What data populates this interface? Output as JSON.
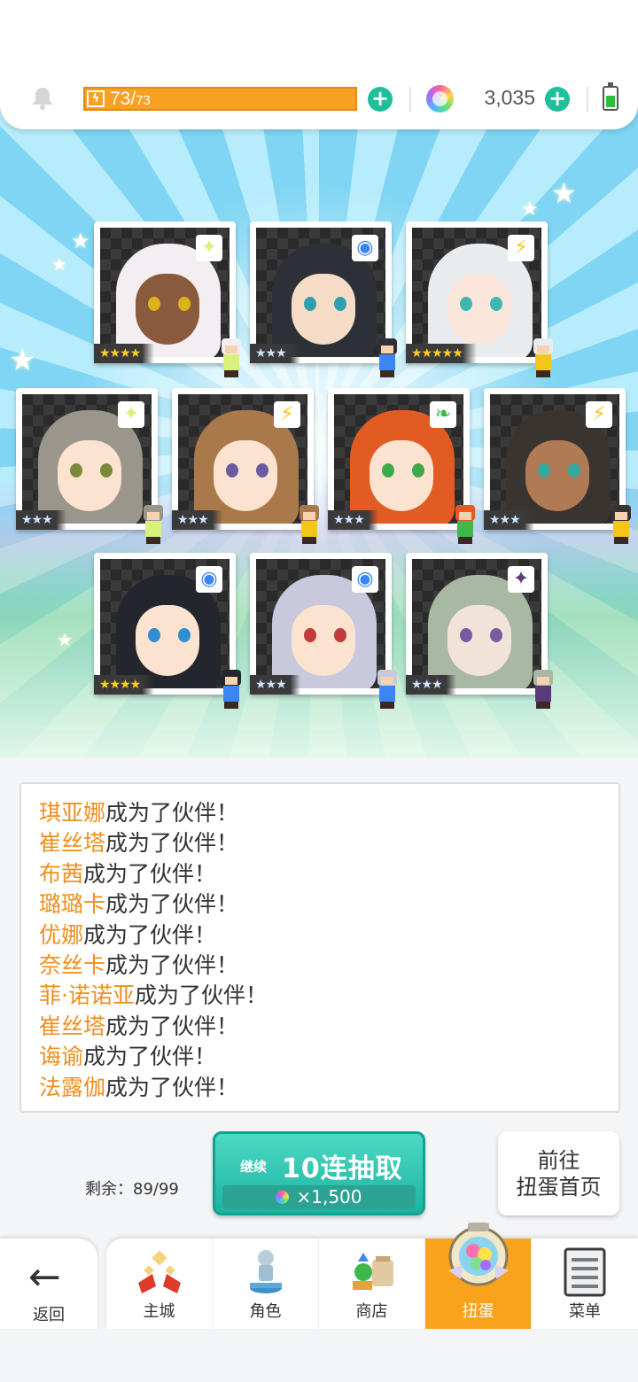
{
  "status": {
    "stamina_current": "73/",
    "stamina_max": "73",
    "gems": "3,035",
    "bolt_icon": "lightning-icon"
  },
  "cards": [
    {
      "stars": "★★★★",
      "rarity": "gold",
      "element": "light",
      "element_glyph": "✦",
      "element_color": "#d9f07a",
      "hair": "#f2eef2",
      "skin": "#8a5a3c",
      "eye": "#e0b21a"
    },
    {
      "stars": "★★★",
      "rarity": "silver",
      "element": "water",
      "element_glyph": "◉",
      "element_color": "#3a86f5",
      "hair": "#2d3036",
      "skin": "#f6dcc6",
      "eye": "#2f9fb0"
    },
    {
      "stars": "★★★★★",
      "rarity": "gold",
      "element": "thunder",
      "element_glyph": "⚡",
      "element_color": "#f4c61a",
      "hair": "#e8ecef",
      "skin": "#fbe6dc",
      "eye": "#3fb6b0"
    },
    {
      "stars": "★★★",
      "rarity": "silver",
      "element": "light",
      "element_glyph": "✦",
      "element_color": "#d9f07a",
      "hair": "#9a968c",
      "skin": "#fbe3cf",
      "eye": "#7a8a3a"
    },
    {
      "stars": "★★★",
      "rarity": "silver",
      "element": "thunder",
      "element_glyph": "⚡",
      "element_color": "#f4c61a",
      "hair": "#a9794a",
      "skin": "#fbe3cf",
      "eye": "#6b5aa0"
    },
    {
      "stars": "★★★",
      "rarity": "silver",
      "element": "wind",
      "element_glyph": "❧",
      "element_color": "#3fb84a",
      "hair": "#e25b22",
      "skin": "#fbe3cf",
      "eye": "#3fa84a"
    },
    {
      "stars": "★★★",
      "rarity": "silver",
      "element": "thunder",
      "element_glyph": "⚡",
      "element_color": "#f4c61a",
      "hair": "#3a3430",
      "skin": "#b07a54",
      "eye": "#35a8a0"
    },
    {
      "stars": "★★★★",
      "rarity": "gold",
      "element": "water",
      "element_glyph": "◉",
      "element_color": "#3a86f5",
      "hair": "#24262e",
      "skin": "#fbe3cf",
      "eye": "#2f8fd0"
    },
    {
      "stars": "★★★",
      "rarity": "silver",
      "element": "water",
      "element_glyph": "◉",
      "element_color": "#3a86f5",
      "hair": "#c9c9de",
      "skin": "#fbe3cf",
      "eye": "#c23a3a"
    },
    {
      "stars": "★★★",
      "rarity": "silver",
      "element": "dark",
      "element_glyph": "✦",
      "element_color": "#5b3a7a",
      "hair": "#a8b8a2",
      "skin": "#f2e3d9",
      "eye": "#7a5aa0"
    }
  ],
  "log": [
    {
      "name": "琪亚娜",
      "text": "成为了伙伴！"
    },
    {
      "name": "崔丝塔",
      "text": "成为了伙伴！"
    },
    {
      "name": "布茜",
      "text": "成为了伙伴！"
    },
    {
      "name": "璐璐卡",
      "text": "成为了伙伴！"
    },
    {
      "name": "优娜",
      "text": "成为了伙伴！"
    },
    {
      "name": "奈丝卡",
      "text": "成为了伙伴！"
    },
    {
      "name": "菲·诺诺亚",
      "text": "成为了伙伴！"
    },
    {
      "name": "崔丝塔",
      "text": "成为了伙伴！"
    },
    {
      "name": "诲谕",
      "text": "成为了伙伴！"
    },
    {
      "name": "法露伽",
      "text": "成为了伙伴！"
    }
  ],
  "draw": {
    "remaining_label": "剩余：",
    "remaining_value": "89/99",
    "continue_label": "继续",
    "title": "10连抽取",
    "cost": "×1,500",
    "goto_line1": "前往",
    "goto_line2": "扭蛋首页"
  },
  "nav": {
    "back": "返回",
    "items": [
      {
        "label": "主城",
        "icon": "castle-icon"
      },
      {
        "label": "角色",
        "icon": "character-icon"
      },
      {
        "label": "商店",
        "icon": "shop-icon"
      },
      {
        "label": "扭蛋",
        "icon": "gacha-icon",
        "active": true
      },
      {
        "label": "菜单",
        "icon": "menu-icon"
      }
    ]
  },
  "colors": {
    "accent_orange": "#f9a21b",
    "teal": "#1fbf9b",
    "name_orange": "#f08f1c"
  }
}
